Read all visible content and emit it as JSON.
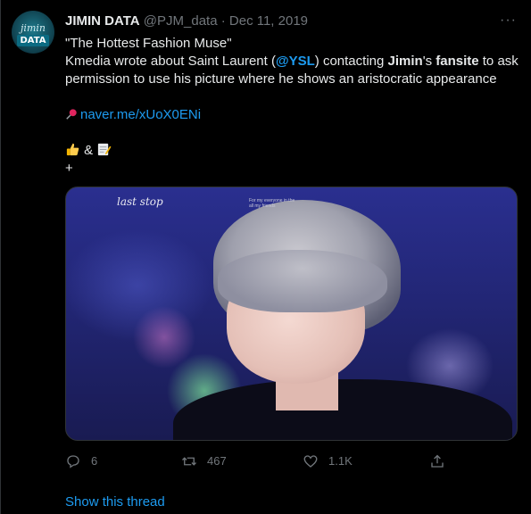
{
  "tweet": {
    "author": {
      "name": "JIMIN DATA",
      "handle": "@PJM_data",
      "avatar_script_text": "jimin",
      "avatar_block_text": "DATA"
    },
    "separator": "·",
    "date": "Dec 11, 2019",
    "more_label": "···",
    "text": {
      "line1": "\"The Hottest Fashion Muse\"",
      "line2_a": "Kmedia wrote about Saint Laurent (",
      "mention": "@YSL",
      "line2_b": ") contacting ",
      "jimin": "Jimin",
      "line2_c": "'s ",
      "fansite": "fansite",
      "line2_d": " to ask permission to use his picture where he shows an aristocratic appearance",
      "link": "naver.me/xUoX0ENi",
      "emoji_amp": "&",
      "plus": "+"
    },
    "media": {
      "caption": "last stop",
      "tiny_text_1": "For my everyone in the",
      "tiny_text_2": "all my friends"
    },
    "actions": {
      "replies": "6",
      "retweets": "467",
      "likes": "1.1K"
    },
    "show_thread": "Show this thread"
  },
  "colors": {
    "background": "#000000",
    "text": "#e7e9ea",
    "muted": "#71767b",
    "link": "#1d9bf0",
    "border": "#2f3336"
  },
  "icons": [
    "pushpin-icon",
    "thumbs-up-icon",
    "memo-icon",
    "reply-icon",
    "retweet-icon",
    "like-icon",
    "share-icon",
    "more-icon"
  ]
}
